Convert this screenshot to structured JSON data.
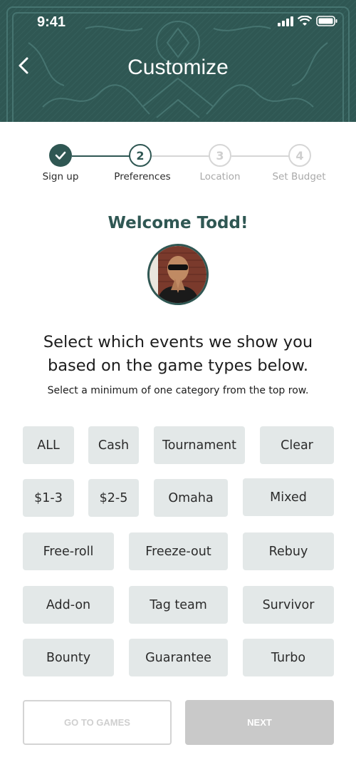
{
  "status_bar": {
    "time": "9:41"
  },
  "header": {
    "title": "Customize"
  },
  "stepper": {
    "steps": [
      {
        "number": "1",
        "label": "Sign up",
        "state": "complete"
      },
      {
        "number": "2",
        "label": "Preferences",
        "state": "current"
      },
      {
        "number": "3",
        "label": "Location",
        "state": "upcoming"
      },
      {
        "number": "4",
        "label": "Set Budget",
        "state": "upcoming"
      }
    ]
  },
  "welcome": {
    "text": "Welcome Todd!"
  },
  "prompt": {
    "line1": "Select which events we show you",
    "line2": "based on the game types below.",
    "hint": "Select a minimum of one category from the top row."
  },
  "chips": {
    "row1": [
      "ALL",
      "Cash",
      "Tournament",
      "Clear"
    ],
    "row2": [
      "$1-3",
      "$2-5",
      "Omaha",
      "Mixed"
    ],
    "row3": [
      "Free-roll",
      "Freeze-out",
      "Rebuy"
    ],
    "row4": [
      "Add-on",
      "Tag team",
      "Survivor"
    ],
    "row5": [
      "Bounty",
      "Guarantee",
      "Turbo"
    ]
  },
  "actions": {
    "go_to_games": "GO TO GAMES",
    "next": "NEXT"
  },
  "colors": {
    "brand": "#2f5753",
    "chip_bg": "#e3e8e8",
    "disabled": "#c9c9c9"
  },
  "icons": [
    "back-chevron-icon",
    "signal-icon",
    "wifi-icon",
    "battery-icon",
    "check-icon"
  ]
}
